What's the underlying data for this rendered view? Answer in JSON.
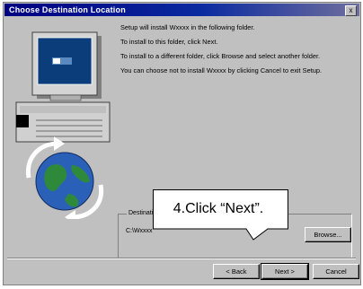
{
  "window": {
    "title": "Choose Destination Location",
    "close_glyph": "x"
  },
  "body_text": {
    "p1": "Setup will install Wxxxx in the following folder.",
    "p2": "To install to this folder, click Next.",
    "p3": "To install to a different folder, click Browse and select another folder.",
    "p4": "You can choose not to install Wxxxx by clicking Cancel to exit Setup."
  },
  "destination": {
    "legend": "Destination Folder",
    "path": "C:\\Wxxxx"
  },
  "buttons": {
    "browse": "Browse...",
    "back": "< Back",
    "next": "Next >",
    "cancel": "Cancel"
  },
  "callout": {
    "text": "4.Click “Next”."
  },
  "icons": {
    "art": "computer-with-globe-icon"
  },
  "colors": {
    "titlebar": "#000080",
    "face": "#c0c0c0"
  }
}
